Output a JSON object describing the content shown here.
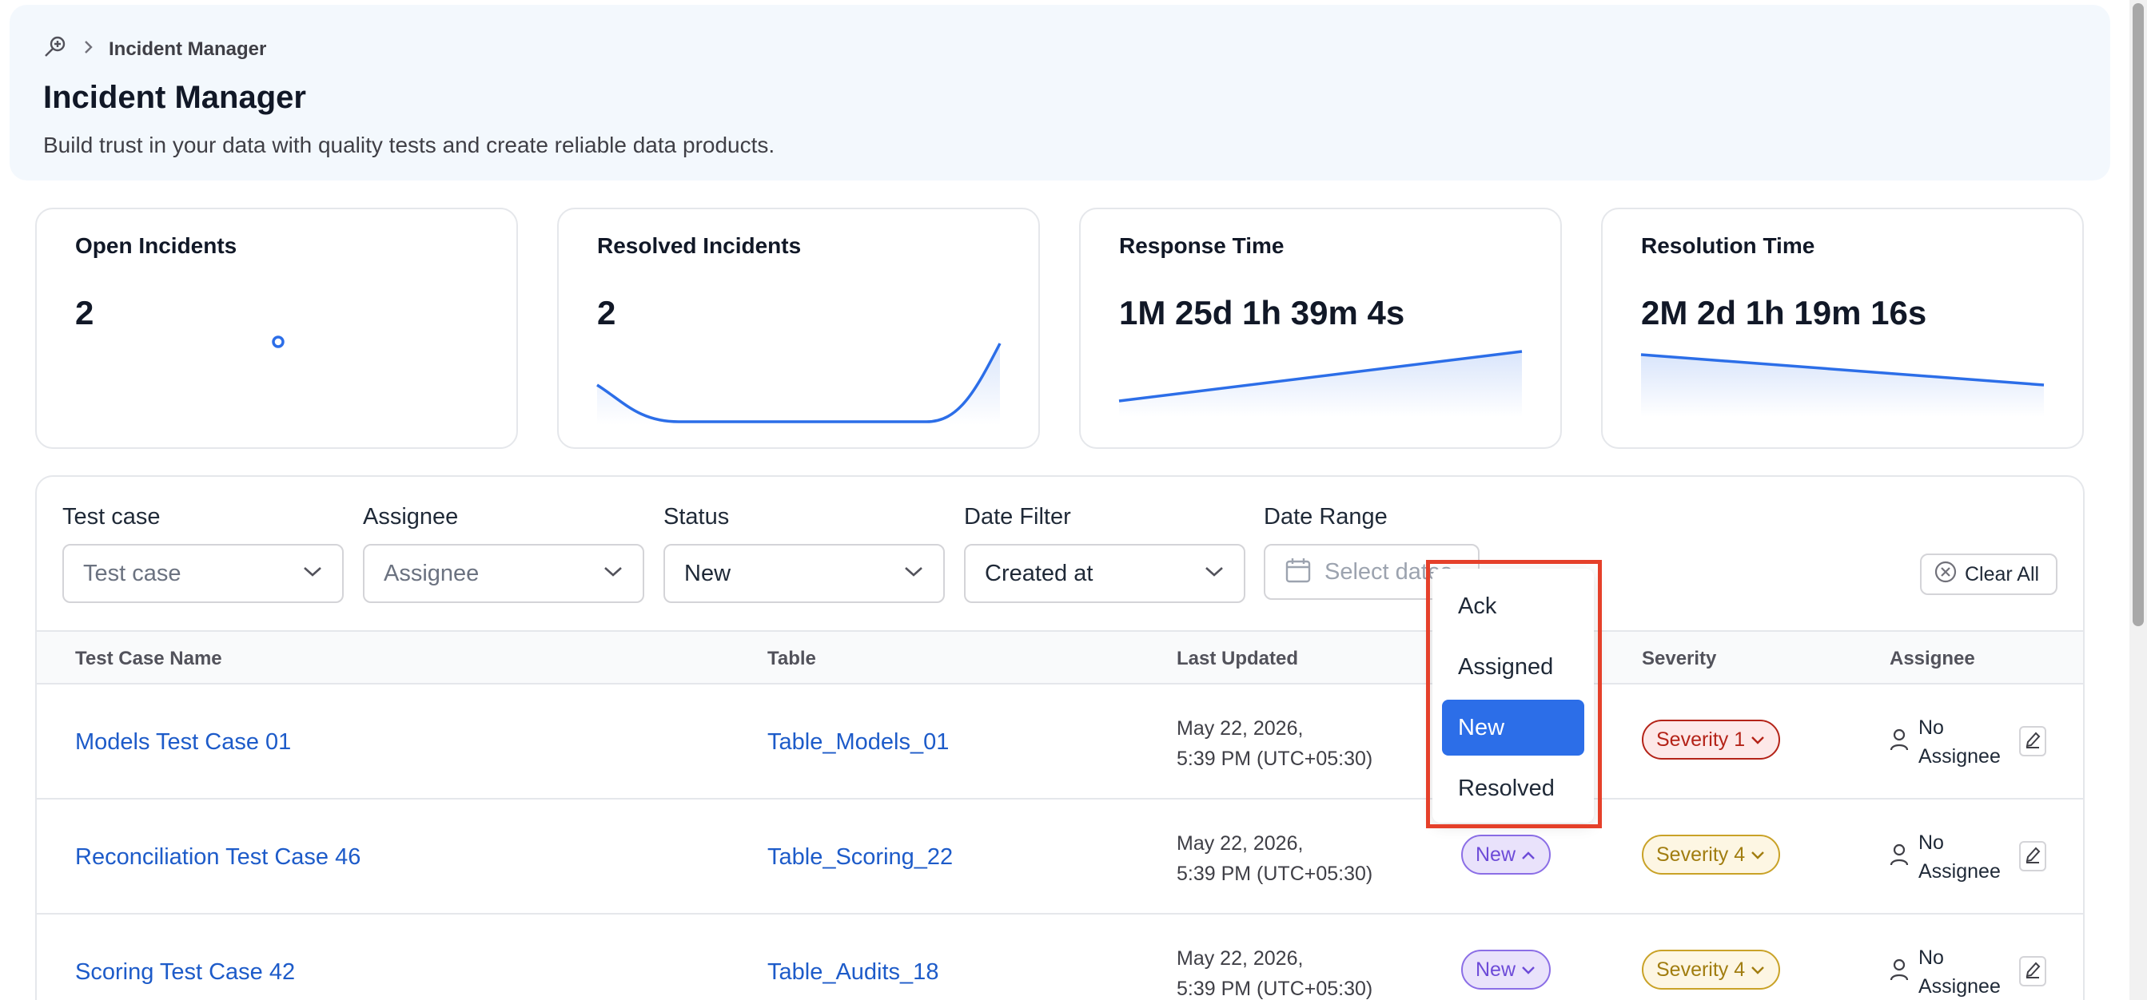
{
  "breadcrumb": {
    "current": "Incident Manager"
  },
  "header": {
    "title": "Incident Manager",
    "subtitle": "Build trust in your data with quality tests and create reliable data products."
  },
  "stats": [
    {
      "title": "Open Incidents",
      "value": "2"
    },
    {
      "title": "Resolved Incidents",
      "value": "2"
    },
    {
      "title": "Response Time",
      "value": "1M 25d 1h 39m 4s"
    },
    {
      "title": "Resolution Time",
      "value": "2M 2d 1h 19m 16s"
    }
  ],
  "filters": {
    "test_case": {
      "label": "Test case",
      "placeholder": "Test case"
    },
    "assignee": {
      "label": "Assignee",
      "placeholder": "Assignee"
    },
    "status": {
      "label": "Status",
      "value": "New"
    },
    "date_filter": {
      "label": "Date Filter",
      "value": "Created at"
    },
    "date_range": {
      "label": "Date Range",
      "placeholder": "Select dates"
    },
    "clear_all": "Clear All"
  },
  "table": {
    "columns": [
      "Test Case Name",
      "Table",
      "Last Updated",
      "Severity",
      "Assignee"
    ],
    "rows": [
      {
        "name": "Models Test Case 01",
        "table": "Table_Models_01",
        "updated_line1": "May 22, 2026,",
        "updated_line2": "5:39 PM (UTC+05:30)",
        "status": "",
        "severity": "Severity 1",
        "assignee_line1": "No",
        "assignee_line2": "Assignee"
      },
      {
        "name": "Reconciliation Test Case 46",
        "table": "Table_Scoring_22",
        "updated_line1": "May 22, 2026,",
        "updated_line2": "5:39 PM (UTC+05:30)",
        "status": "New",
        "severity": "Severity 4",
        "assignee_line1": "No",
        "assignee_line2": "Assignee"
      },
      {
        "name": "Scoring Test Case 42",
        "table": "Table_Audits_18",
        "updated_line1": "May 22, 2026,",
        "updated_line2": "5:39 PM (UTC+05:30)",
        "status": "New",
        "severity": "Severity 4",
        "assignee_line1": "No",
        "assignee_line2": "Assignee"
      }
    ]
  },
  "status_dropdown": {
    "options": [
      "Ack",
      "Assigned",
      "New",
      "Resolved"
    ],
    "selected": "New"
  },
  "colors": {
    "accent": "#2c6ee8",
    "link": "#1d5bc9",
    "highlight_border": "#e5402a",
    "severity1": "#b42318",
    "severity4": "#c9a227",
    "status_new": "#6d4bd8"
  }
}
